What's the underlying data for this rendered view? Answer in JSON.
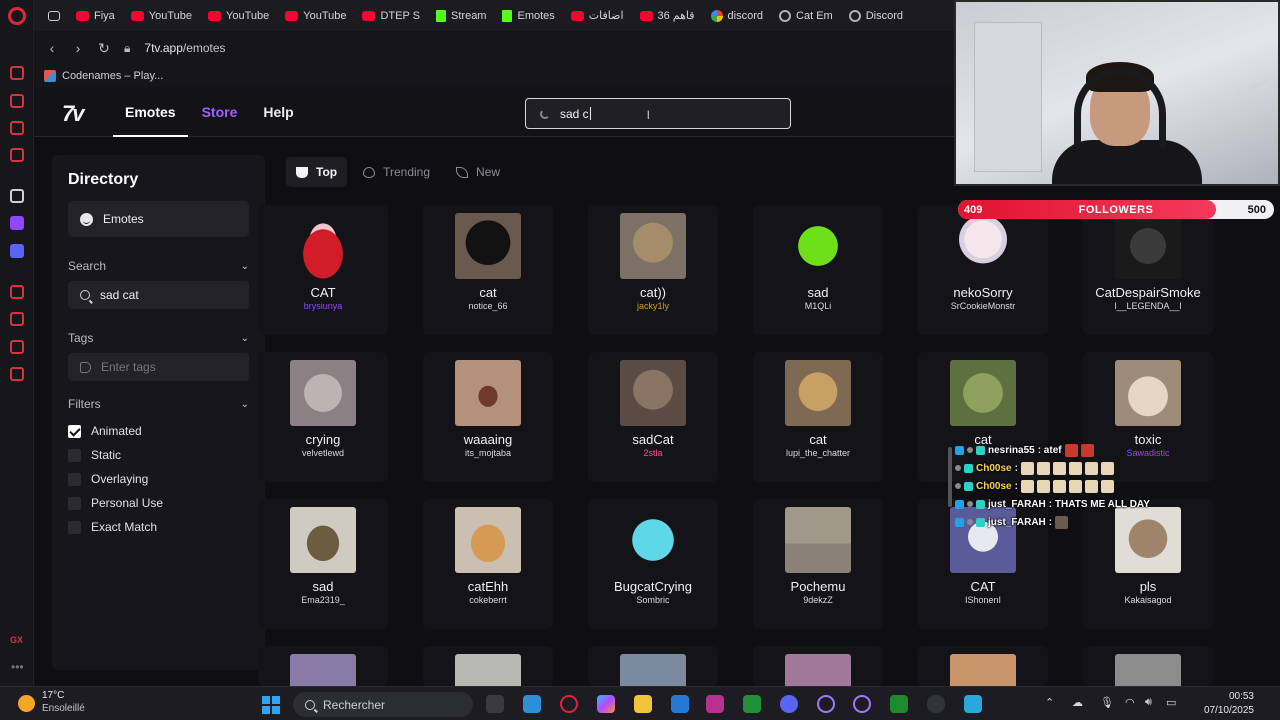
{
  "bookmarks": [
    {
      "label": "Fiya",
      "icon": "youtube-icon"
    },
    {
      "label": "YouTube",
      "icon": "youtube-icon"
    },
    {
      "label": "YouTube",
      "icon": "youtube-icon"
    },
    {
      "label": "YouTube",
      "icon": "youtube-icon"
    },
    {
      "label": "DTEP S",
      "icon": "youtube-icon"
    },
    {
      "label": "Stream",
      "icon": "kick-icon"
    },
    {
      "label": "Emotes",
      "icon": "kick-icon"
    },
    {
      "label": "اضافات",
      "icon": "youtube-icon"
    },
    {
      "label": "قاهم 36",
      "icon": "youtube-icon"
    },
    {
      "label": "discord",
      "icon": "google-icon"
    },
    {
      "label": "Cat Em",
      "icon": "opera-icon"
    },
    {
      "label": "Discord",
      "icon": "opera-icon"
    }
  ],
  "address": {
    "host": "7tv.app",
    "path": "/emotes"
  },
  "tab": {
    "title": "Codenames – Play..."
  },
  "site": {
    "logo": "7tv",
    "nav": {
      "emotes": "Emotes",
      "store": "Store",
      "help": "Help"
    },
    "search_value": "sad c"
  },
  "directory": {
    "title": "Directory",
    "emotes_item": "Emotes",
    "search_label": "Search",
    "search_value": "sad cat",
    "tags_label": "Tags",
    "tags_placeholder": "Enter tags",
    "filters_label": "Filters",
    "filters": [
      {
        "label": "Animated",
        "checked": true
      },
      {
        "label": "Static",
        "checked": false
      },
      {
        "label": "Overlaying",
        "checked": false
      },
      {
        "label": "Personal Use",
        "checked": false
      },
      {
        "label": "Exact Match",
        "checked": false
      }
    ]
  },
  "sort_tabs": [
    {
      "label": "Top",
      "active": true
    },
    {
      "label": "Trending",
      "active": false
    },
    {
      "label": "New",
      "active": false
    }
  ],
  "emotes": [
    {
      "name": "CAT",
      "author": "brysiunya",
      "author_color": "purple"
    },
    {
      "name": "cat",
      "author": "notice_66",
      "author_color": "default"
    },
    {
      "name": "cat))",
      "author": "jacky1ly",
      "author_color": "gold"
    },
    {
      "name": "sad",
      "author": "M1QLi",
      "author_color": "default"
    },
    {
      "name": "nekoSorry",
      "author": "SrCookieMonstr",
      "author_color": "default"
    },
    {
      "name": "CatDespairSmoke",
      "author": "l__LEGENDA__l",
      "author_color": "default"
    },
    {
      "name": "crying",
      "author": "velvetlewd",
      "author_color": "default"
    },
    {
      "name": "waaaing",
      "author": "its_mojtaba",
      "author_color": "default"
    },
    {
      "name": "sadCat",
      "author": "2stla",
      "author_color": "pink"
    },
    {
      "name": "cat",
      "author": "lupi_the_chatter",
      "author_color": "default"
    },
    {
      "name": "cat",
      "author": "",
      "author_color": "default"
    },
    {
      "name": "toxic",
      "author": "Sawadistic",
      "author_color": "purple"
    },
    {
      "name": "sad",
      "author": "Ema2319_",
      "author_color": "default"
    },
    {
      "name": "catEhh",
      "author": "cokeberrt",
      "author_color": "default"
    },
    {
      "name": "BugcatCrying",
      "author": "Sombric",
      "author_color": "default"
    },
    {
      "name": "Pochemu",
      "author": "9dekzZ",
      "author_color": "default"
    },
    {
      "name": "CAT",
      "author": "IShonenI",
      "author_color": "default"
    },
    {
      "name": "pls",
      "author": "Kakaisagod",
      "author_color": "default"
    }
  ],
  "overlay": {
    "followers_label": "FOLLOWERS",
    "followers_current": "409",
    "followers_goal": "500",
    "followers_fraction": 0.818
  },
  "chat": [
    {
      "user": "nesrina55",
      "text": ": atef",
      "user_color": "white"
    },
    {
      "user": "Ch00se",
      "text": ":",
      "user_color": "yellow"
    },
    {
      "user": "Ch00se",
      "text": ":",
      "user_color": "yellow"
    },
    {
      "user": "just_FARAH",
      "text": ": THATS ME ALL DAY",
      "user_color": "white"
    },
    {
      "user": "just_FARAH",
      "text": ":",
      "user_color": "white"
    }
  ],
  "taskbar": {
    "temperature": "17°C",
    "weather": "Ensoleillé",
    "search_placeholder": "Rechercher",
    "time": "00:53",
    "date": "07/10/2025"
  }
}
